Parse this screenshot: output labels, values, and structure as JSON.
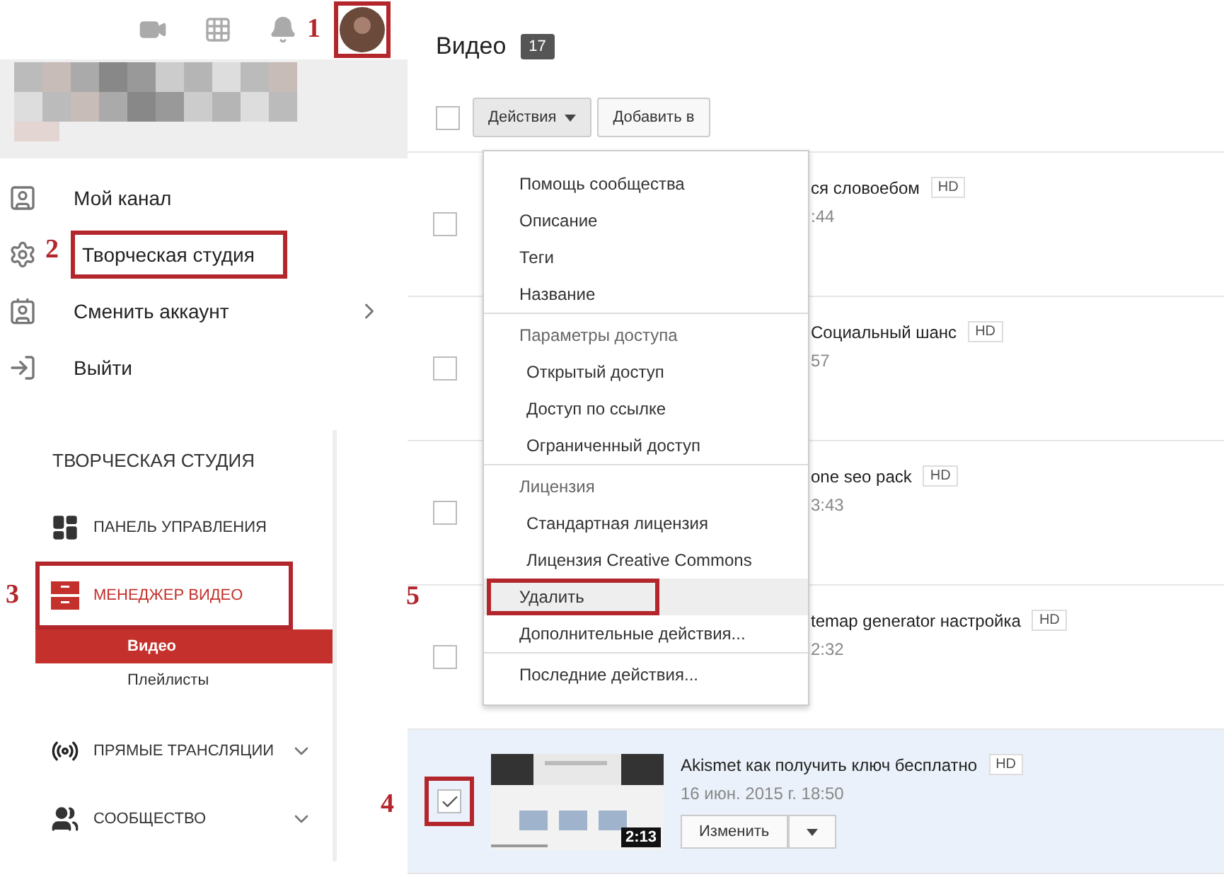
{
  "header": {
    "avatar_annotation": "1"
  },
  "account_menu": [
    {
      "label": "Мой канал",
      "has_submenu": false
    },
    {
      "label": "Творческая студия",
      "has_submenu": false,
      "annotation": "2"
    },
    {
      "label": "Сменить аккаунт",
      "has_submenu": true
    },
    {
      "label": "Выйти",
      "has_submenu": false
    }
  ],
  "studio": {
    "title": "ТВОРЧЕСКАЯ СТУДИЯ",
    "items": [
      {
        "label": "ПАНЕЛЬ УПРАВЛЕНИЯ",
        "active": false,
        "expandable": false
      },
      {
        "label": "МЕНЕДЖЕР ВИДЕО",
        "active": true,
        "expandable": false,
        "annotation": "3",
        "children": [
          {
            "label": "Видео",
            "selected": true
          },
          {
            "label": "Плейлисты",
            "selected": false
          }
        ]
      },
      {
        "label": "ПРЯМЫЕ ТРАНСЛЯЦИИ",
        "active": false,
        "expandable": true
      },
      {
        "label": "СООБЩЕСТВО",
        "active": false,
        "expandable": true
      }
    ]
  },
  "videos": {
    "title": "Видео",
    "count": "17",
    "toolbar": {
      "select_all_checked": false,
      "buttons": [
        {
          "label": "Действия",
          "open": true
        },
        {
          "label": "Добавить в",
          "open": false
        }
      ]
    },
    "actions_menu": [
      [
        {
          "label": "Помощь сообщества",
          "kind": "item",
          "highlighted": false
        },
        {
          "label": "Описание",
          "kind": "item",
          "highlighted": false
        },
        {
          "label": "Теги",
          "kind": "item",
          "highlighted": false
        },
        {
          "label": "Название",
          "kind": "item",
          "highlighted": false
        }
      ],
      [
        {
          "label": "Параметры доступа",
          "kind": "header",
          "highlighted": false
        },
        {
          "label": "Открытый доступ",
          "kind": "sub",
          "highlighted": false
        },
        {
          "label": "Доступ по ссылке",
          "kind": "sub",
          "highlighted": false
        },
        {
          "label": "Ограниченный доступ",
          "kind": "sub",
          "highlighted": false
        }
      ],
      [
        {
          "label": "Лицензия",
          "kind": "header",
          "highlighted": false
        },
        {
          "label": "Стандартная лицензия",
          "kind": "sub",
          "highlighted": false
        },
        {
          "label": "Лицензия Creative Commons",
          "kind": "sub",
          "highlighted": false
        },
        {
          "label": "Удалить",
          "kind": "item",
          "highlighted": true,
          "annotation": "5"
        },
        {
          "label": "Дополнительные действия...",
          "kind": "item",
          "highlighted": false
        }
      ],
      [
        {
          "label": "Последние действия...",
          "kind": "item",
          "highlighted": false
        }
      ]
    ],
    "rows": [
      {
        "kind": "covered",
        "title": "ся словоебом",
        "badge": "HD",
        "meta": ":44",
        "checked": false
      },
      {
        "kind": "covered",
        "title": "Социальный шанс",
        "badge": "HD",
        "meta": "57",
        "checked": false
      },
      {
        "kind": "covered",
        "title": "one seo pack",
        "badge": "HD",
        "meta": "3:43",
        "checked": false
      },
      {
        "kind": "covered",
        "title": "temap generator настройка",
        "badge": "HD",
        "meta": "2:32",
        "checked": false
      },
      {
        "kind": "full",
        "title": "Akismet как получить ключ бесплатно",
        "badge": "HD",
        "meta": "16 июн. 2015 г. 18:50",
        "duration": "2:13",
        "edit": "Изменить",
        "checked": true,
        "annotation": "4"
      }
    ]
  }
}
